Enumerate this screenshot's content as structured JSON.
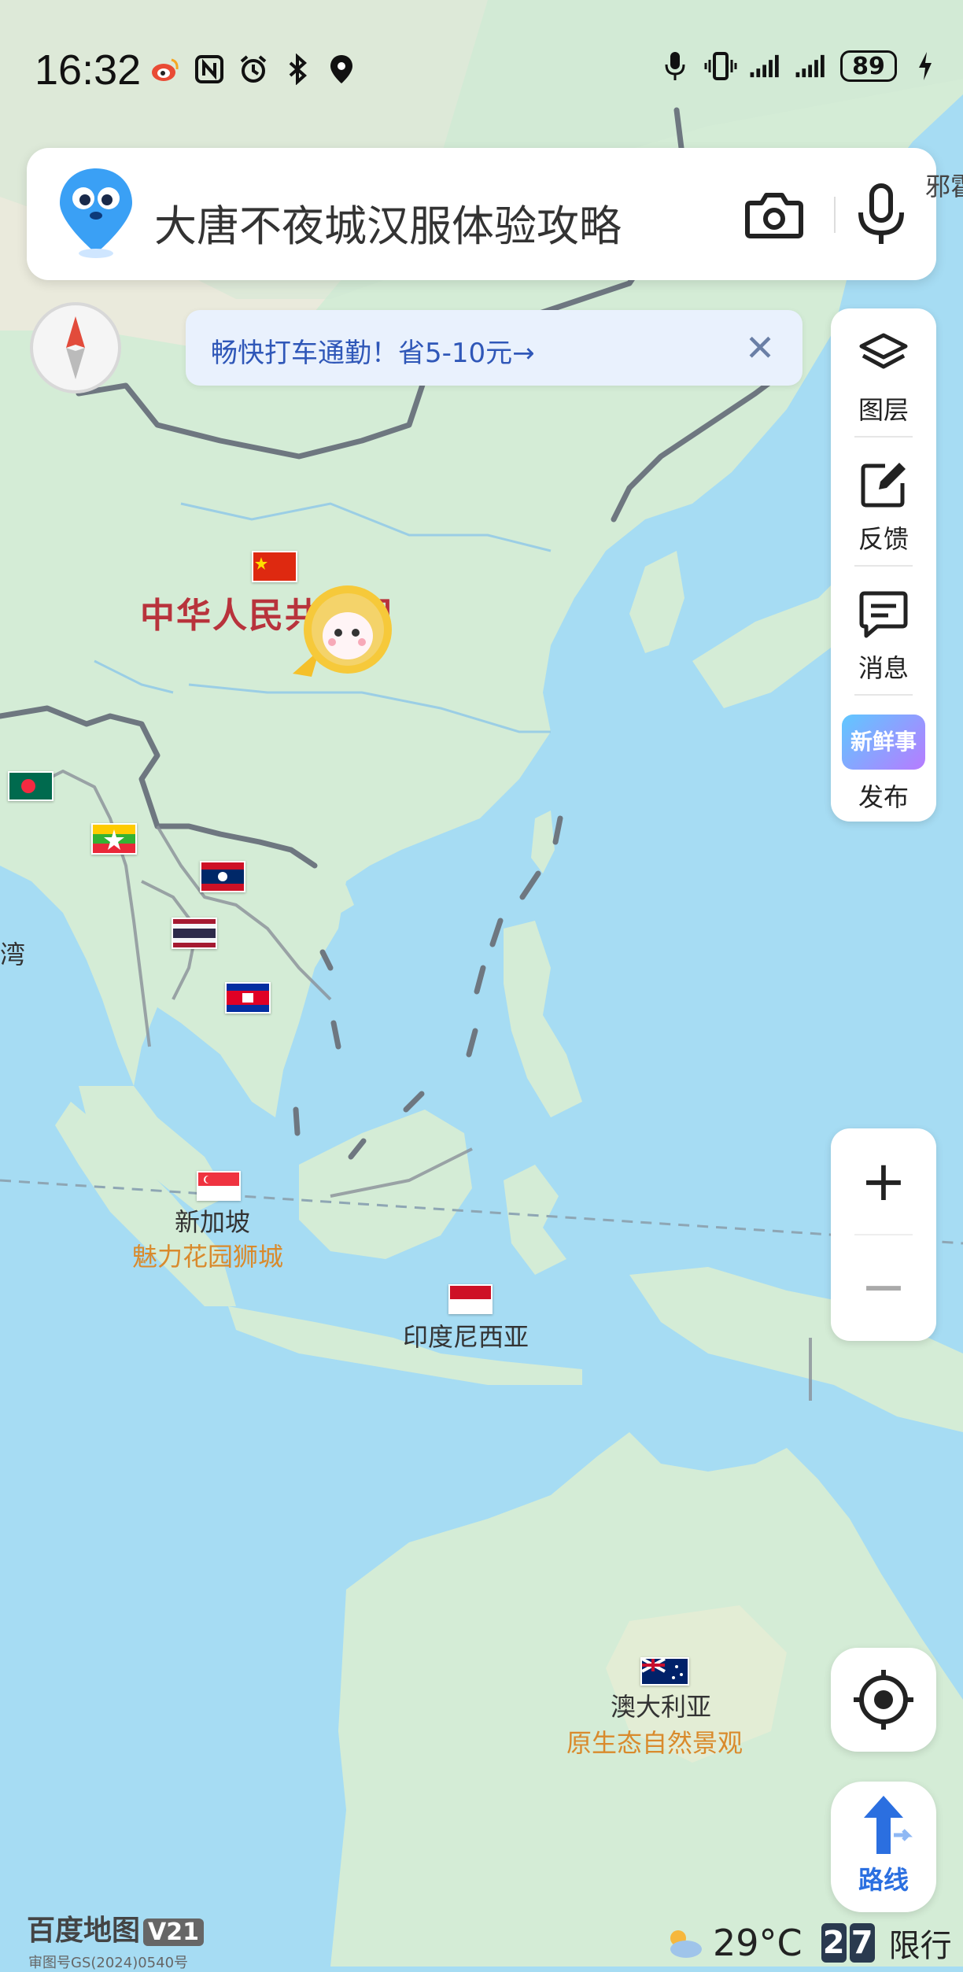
{
  "status_bar": {
    "time": "16:32",
    "battery": "89"
  },
  "search": {
    "query": "大唐不夜城汉服体验攻略"
  },
  "promo": {
    "text": "畅快打车通勤！省5-10元→",
    "close": "✕"
  },
  "tools": [
    {
      "label": "图层",
      "icon": "layers-icon"
    },
    {
      "label": "反馈",
      "icon": "edit-feedback-icon"
    },
    {
      "label": "消息",
      "icon": "message-icon"
    },
    {
      "label": "发布",
      "icon": "fresh-news-icon",
      "badge": "新鲜事"
    }
  ],
  "zoom": {
    "in": "+",
    "out": "−"
  },
  "route": {
    "label": "路线"
  },
  "map_labels": {
    "china": "中华人民共和国",
    "singapore": "新加坡",
    "singapore_tag": "魅力花园狮城",
    "indonesia": "印度尼西亚",
    "australia": "澳大利亚",
    "australia_tag": "原生态自然景观",
    "left_edge": "湾",
    "right_edge": "邪霍"
  },
  "footer": {
    "logo": "百度地图",
    "logo_version": "V21",
    "approval": "审图号GS(2024)0540号",
    "temperature": "29°C",
    "plate_digits": [
      "2",
      "7"
    ],
    "restriction": "限行"
  },
  "colors": {
    "sea": "#a6dcf3",
    "land": "#d6ecd8",
    "border": "#6e7780",
    "accent_blue": "#2b6fe0"
  }
}
